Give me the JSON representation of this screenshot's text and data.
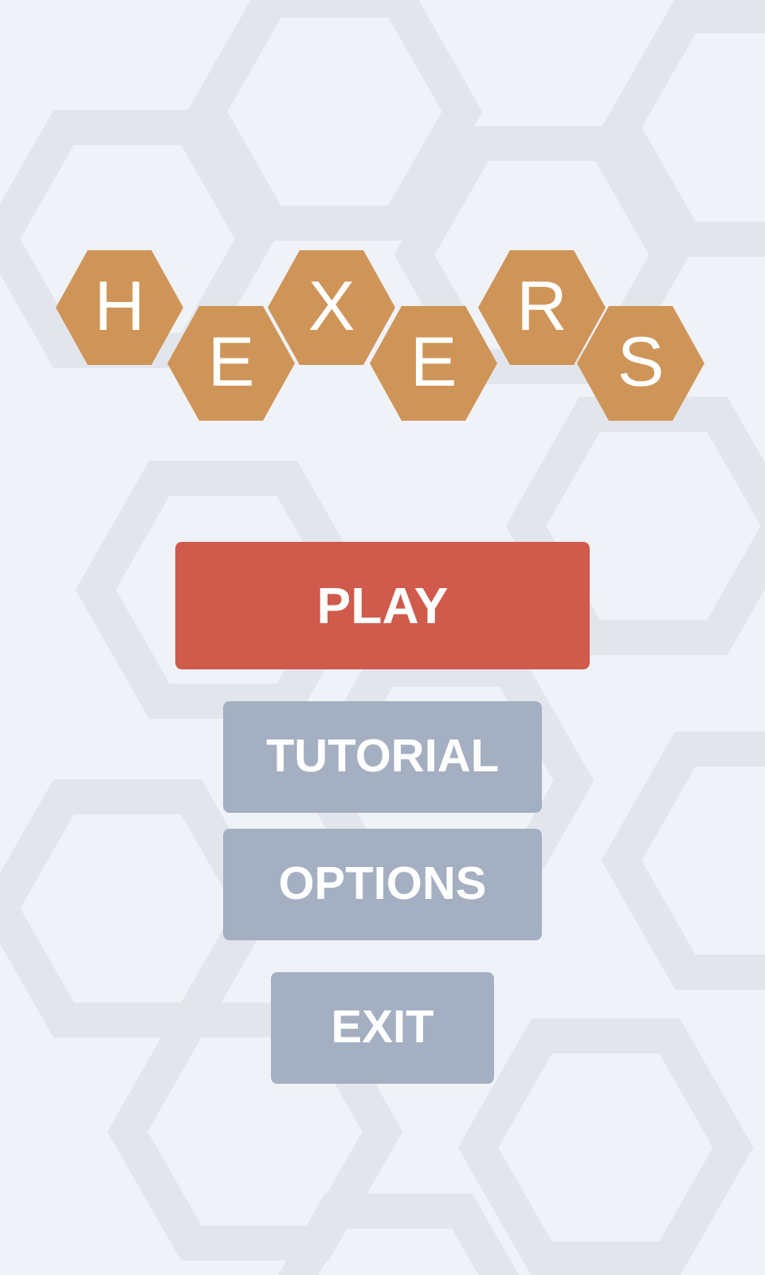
{
  "logo": {
    "letters": [
      "H",
      "E",
      "X",
      "E",
      "R",
      "S"
    ]
  },
  "buttons": [
    {
      "label": "PLAY",
      "kind": "primary"
    },
    {
      "label": "TUTORIAL",
      "kind": "secondary"
    },
    {
      "label": "OPTIONS",
      "kind": "secondary"
    },
    {
      "label": "EXIT",
      "kind": "secondary"
    }
  ]
}
